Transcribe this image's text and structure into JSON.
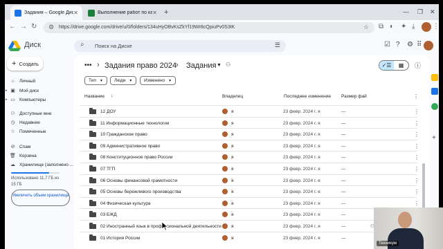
{
  "browser": {
    "tabs": [
      {
        "title": "Задания – Google Диск",
        "favicon_color": "#1a73e8",
        "active": true
      },
      {
        "title": "Выполнение работ по каждо",
        "favicon_color": "#188038",
        "active": false
      }
    ],
    "url": "https://drive.google.com/drive/u/0/folders/134uHyOBvKsZkYf19Wr8cQpiuPv0S3tK"
  },
  "drive": {
    "app_name": "Диск",
    "search_placeholder": "Поиск на Диске",
    "create_label": "Создать",
    "nav_items": [
      {
        "label": "Личный",
        "icon": "home-icon"
      },
      {
        "label": "Мой диск",
        "icon": "drive-icon"
      },
      {
        "label": "Компьютеры",
        "icon": "computer-icon"
      },
      {
        "label": "Доступные мне",
        "icon": "shared-icon"
      },
      {
        "label": "Недавние",
        "icon": "clock-icon"
      },
      {
        "label": "Помеченные",
        "icon": "star-icon"
      },
      {
        "label": "Спам",
        "icon": "spam-icon"
      },
      {
        "label": "Корзина",
        "icon": "trash-icon"
      },
      {
        "label": "Хранилище (заполнено ...",
        "icon": "cloud-icon"
      }
    ],
    "storage": {
      "text": "Использовано 11,7 ГБ из 15 ГБ",
      "fraction": 0.78
    },
    "upgrade_label": "Увеличить объем хранилища"
  },
  "breadcrumb": {
    "parent": "Задания право 2024",
    "current": "Задания"
  },
  "filters": [
    "Тип",
    "Люди",
    "Изменено"
  ],
  "columns": {
    "name": "Название",
    "owner": "Владелец",
    "modified": "Последнее изменение",
    "size": "Размер фай"
  },
  "rows": [
    {
      "name": "12 ДОУ",
      "owner": "я",
      "modified": "23 февр. 2024 г. я",
      "size": "—"
    },
    {
      "name": "11 Информационные технологии",
      "owner": "я",
      "modified": "23 февр. 2024 г. я",
      "size": "—"
    },
    {
      "name": "10 Гражданское право",
      "owner": "я",
      "modified": "23 февр. 2024 г. я",
      "size": "—"
    },
    {
      "name": "09 Административное право",
      "owner": "я",
      "modified": "23 февр. 2024 г. я",
      "size": "—"
    },
    {
      "name": "08 Конституционное право России",
      "owner": "я",
      "modified": "23 февр. 2024 г. я",
      "size": "—"
    },
    {
      "name": "07 ТГП",
      "owner": "я",
      "modified": "23 февр. 2024 г. я",
      "size": "—"
    },
    {
      "name": "06 Основы финансовой грамотности",
      "owner": "я",
      "modified": "23 февр. 2024 г. я",
      "size": "—"
    },
    {
      "name": "05 Основы бережливого производства",
      "owner": "я",
      "modified": "23 февр. 2024 г. я",
      "size": "—"
    },
    {
      "name": "04 Физическая культура",
      "owner": "я",
      "modified": "23 февр. 2024 г. я",
      "size": "—"
    },
    {
      "name": "03 БЖД",
      "owner": "я",
      "modified": "23 февр. 2024 г. я",
      "size": "—"
    },
    {
      "name": "02 Иностранный язык в профессиональной деятельности",
      "owner": "я",
      "modified": "23 февр. 2024 г. я",
      "size": "—"
    },
    {
      "name": "01 История России",
      "owner": "я",
      "modified": "23 февр. 2024 г. я",
      "size": "—"
    }
  ],
  "webcam": {
    "label": "Техникум"
  }
}
